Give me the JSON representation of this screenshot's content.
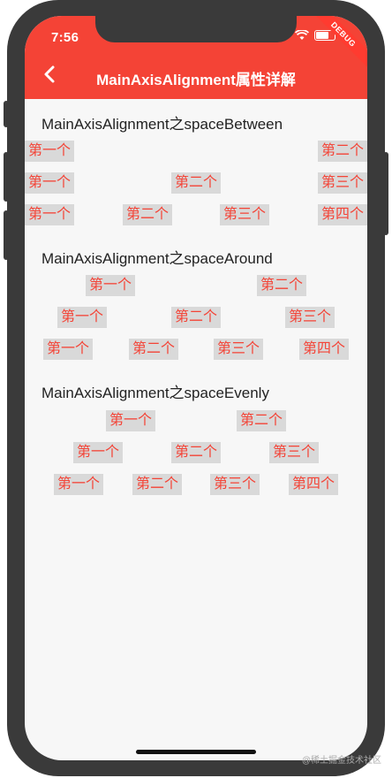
{
  "status_bar": {
    "time": "7:56",
    "debug_banner": "DEBUG"
  },
  "app_bar": {
    "title": "MainAxisAlignment属性详解"
  },
  "sections": [
    {
      "title": "MainAxisAlignment之spaceBetween",
      "rows": [
        [
          "第一个",
          "第二个"
        ],
        [
          "第一个",
          "第二个",
          "第三个"
        ],
        [
          "第一个",
          "第二个",
          "第三个",
          "第四个"
        ]
      ]
    },
    {
      "title": "MainAxisAlignment之spaceAround",
      "rows": [
        [
          "第一个",
          "第二个"
        ],
        [
          "第一个",
          "第二个",
          "第三个"
        ],
        [
          "第一个",
          "第二个",
          "第三个",
          "第四个"
        ]
      ]
    },
    {
      "title": "MainAxisAlignment之spaceEvenly",
      "rows": [
        [
          "第一个",
          "第二个"
        ],
        [
          "第一个",
          "第二个",
          "第三个"
        ],
        [
          "第一个",
          "第二个",
          "第三个",
          "第四个"
        ]
      ]
    }
  ],
  "watermark": "@稀土掘金技术社区",
  "colors": {
    "accent": "#f44336",
    "chip_bg": "#d9d9d9",
    "frame": "#3a3a3a",
    "background": "#f7f7f7"
  }
}
